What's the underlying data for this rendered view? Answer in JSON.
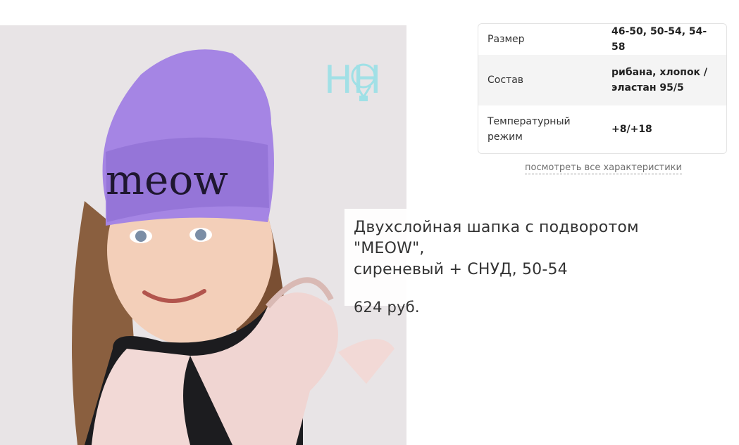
{
  "product": {
    "photo_alt": "Girl wearing lilac MEOW beanie",
    "hat_print": "meow",
    "logo_text": "HH",
    "title_line1": "Двухслойная шапка с подворотом \"MEOW\",",
    "title_line2": "сиреневый + СНУД, 50-54",
    "price": "624 руб."
  },
  "specs": {
    "rows": [
      {
        "key": "Размер",
        "value": "46-50, 50-54, 54-58"
      },
      {
        "key": "Состав",
        "value_line1": "рибана, хлопок /",
        "value_line2": "эластан 95/5"
      },
      {
        "key_line1": "Температурный",
        "key_line2": "режим",
        "value": "+8/+18"
      }
    ],
    "all_link": "посмотреть все характеристики"
  },
  "colors": {
    "hat": "#a585e4",
    "logo": "#9fe0e6",
    "vest": "#f0d5d2"
  }
}
